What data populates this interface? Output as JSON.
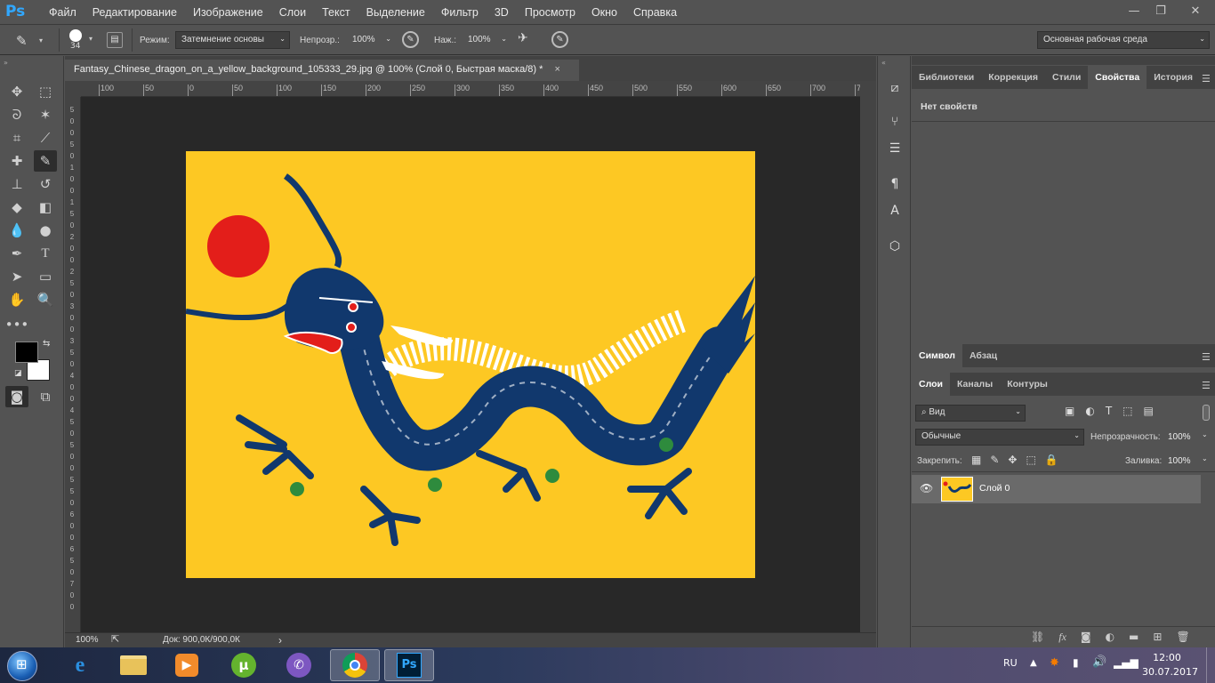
{
  "app": {
    "logo": "Ps",
    "menu": [
      "Файл",
      "Редактирование",
      "Изображение",
      "Слои",
      "Текст",
      "Выделение",
      "Фильтр",
      "3D",
      "Просмотр",
      "Окно",
      "Справка"
    ]
  },
  "options": {
    "brush_size": "34",
    "mode_label": "Режим:",
    "mode_value": "Затемнение основы",
    "opacity_label": "Непрозр.:",
    "opacity_value": "100%",
    "pressure_label": "Наж.:",
    "pressure_value": "100%",
    "workspace": "Основная рабочая среда"
  },
  "document": {
    "tab_title": "Fantasy_Chinese_dragon_on_a_yellow_background_105333_29.jpg @ 100% (Слой 0, Быстрая маска/8) *",
    "close": "×",
    "ruler_h": [
      "100",
      "50",
      "0",
      "50",
      "100",
      "150",
      "200",
      "250",
      "300",
      "350",
      "400",
      "450",
      "500",
      "550",
      "600",
      "650",
      "700",
      "7"
    ],
    "ruler_v": [
      "5",
      "0",
      "0",
      "5",
      "0",
      "1",
      "0",
      "0",
      "1",
      "5",
      "0",
      "2",
      "0",
      "0",
      "2",
      "5",
      "0",
      "3",
      "0",
      "0",
      "3",
      "5",
      "0",
      "4",
      "0",
      "0",
      "4",
      "5",
      "0",
      "5",
      "0",
      "0",
      "5",
      "5",
      "0",
      "6",
      "0",
      "0",
      "6",
      "5",
      "0",
      "7",
      "0",
      "0"
    ],
    "zoom": "100%",
    "doc_info": "Док: 900,0К/900,0К",
    "status_arrow": "›"
  },
  "panels": {
    "top_tabs": [
      "Библиотеки",
      "Коррекция",
      "Стили",
      "Свойства",
      "История"
    ],
    "properties_empty": "Нет свойств",
    "char_tabs": [
      "Символ",
      "Абзац"
    ],
    "layer_tabs": [
      "Слои",
      "Каналы",
      "Контуры"
    ],
    "filter_kind": "Вид",
    "blend_mode": "Обычные",
    "opacity_label": "Непрозрачность:",
    "opacity_value": "100%",
    "lock_label": "Закрепить:",
    "fill_label": "Заливка:",
    "fill_value": "100%",
    "layer_name": "Слой 0"
  },
  "taskbar": {
    "lang": "RU",
    "time": "12:00",
    "date": "30.07.2017"
  },
  "colors": {
    "flag_yellow": "#fdc823",
    "sun_red": "#e31e1a",
    "dragon_blue": "#11386d",
    "ps_blue": "#31a8ff"
  }
}
